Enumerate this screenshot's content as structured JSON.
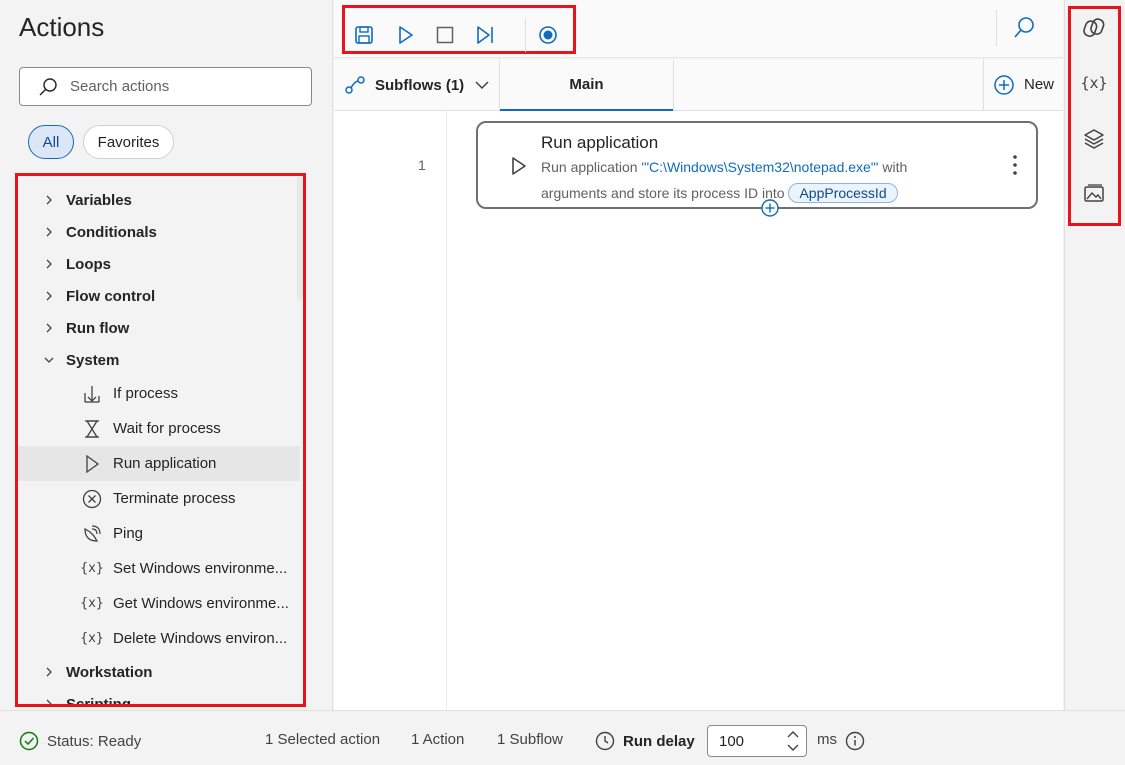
{
  "actions_pane": {
    "title": "Actions",
    "search_placeholder": "Search actions",
    "filters": {
      "all": "All",
      "favorites": "Favorites"
    },
    "categories": [
      {
        "label": "Variables",
        "expanded": false
      },
      {
        "label": "Conditionals",
        "expanded": false
      },
      {
        "label": "Loops",
        "expanded": false
      },
      {
        "label": "Flow control",
        "expanded": false
      },
      {
        "label": "Run flow",
        "expanded": false
      },
      {
        "label": "System",
        "expanded": true
      },
      {
        "label": "Workstation",
        "expanded": false
      },
      {
        "label": "Scripting",
        "expanded": false
      }
    ],
    "system_items": [
      {
        "label": "If process",
        "icon": "if-process-icon"
      },
      {
        "label": "Wait for process",
        "icon": "hourglass-icon"
      },
      {
        "label": "Run application",
        "icon": "play-icon",
        "selected": true
      },
      {
        "label": "Terminate process",
        "icon": "terminate-icon"
      },
      {
        "label": "Ping",
        "icon": "ping-icon"
      },
      {
        "label": "Set Windows environme...",
        "icon": "variable-icon"
      },
      {
        "label": "Get Windows environme...",
        "icon": "variable-icon"
      },
      {
        "label": "Delete Windows environ...",
        "icon": "variable-icon"
      }
    ],
    "variable_glyph": "{x}"
  },
  "toolbar": {
    "buttons": [
      "save-icon",
      "run-icon",
      "stop-icon",
      "run-next-icon",
      "record-icon"
    ],
    "search_icon": "search-icon"
  },
  "tabbar": {
    "subflows_label": "Subflows (1)",
    "main_tab": "Main",
    "new_label": "New"
  },
  "canvas": {
    "line_number": "1",
    "action": {
      "title": "Run application",
      "desc_prefix": "Run application ",
      "desc_path": "'\"C:\\Windows\\System32\\notepad.exe\"'",
      "desc_middle": " with arguments  and store its process ID into ",
      "desc_var": "AppProcessId"
    }
  },
  "right_rail": {
    "items": [
      "copilot-icon",
      "variables-icon",
      "ui-elements-icon",
      "images-icon"
    ],
    "variables_glyph": "{x}"
  },
  "statusbar": {
    "status": "Status: Ready",
    "selected": "1 Selected action",
    "actions": "1 Action",
    "subflows": "1 Subflow",
    "run_delay_label": "Run delay",
    "run_delay_value": "100",
    "unit": "ms"
  },
  "colors": {
    "accent": "#0f6cbd",
    "highlight_box": "#e8141c",
    "status_ok": "#107c10"
  }
}
